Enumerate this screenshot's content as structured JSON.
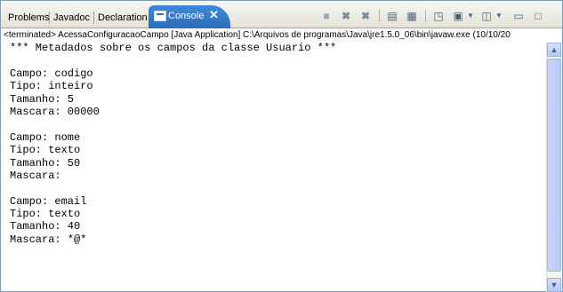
{
  "tabs": [
    {
      "label": "Problems"
    },
    {
      "label": "Javadoc"
    },
    {
      "label": "Declaration"
    },
    {
      "label": "Console",
      "active": true
    }
  ],
  "active_tab": {
    "label": "Console",
    "close_glyph": "✕"
  },
  "toolbar": {
    "icons": [
      "terminate-icon",
      "remove-launch-icon",
      "remove-all-terminated-icon",
      "scroll-lock-icon",
      "word-wrap-icon",
      "pin-console-icon",
      "display-selected-console-icon",
      "open-console-icon",
      "minimize-icon",
      "maximize-icon"
    ]
  },
  "status_line": "<terminated> AcessaConfiguracaoCampo [Java Application] C:\\Arquivos de programas\\Java\\jre1.5.0_06\\bin\\javaw.exe (10/10/20",
  "console_lines": [
    "*** Metadados sobre os campos da classe Usuario ***",
    "",
    "Campo: codigo",
    "Tipo: inteiro",
    "Tamanho: 5",
    "Mascara: 00000",
    "",
    "Campo: nome",
    "Tipo: texto",
    "Tamanho: 50",
    "Mascara:",
    "",
    "Campo: email",
    "Tipo: texto",
    "Tamanho: 40",
    "Mascara: *@*"
  ],
  "colors": {
    "active_tab": "#2c6dbb",
    "border": "#7f9db9",
    "background": "#ffffff"
  }
}
